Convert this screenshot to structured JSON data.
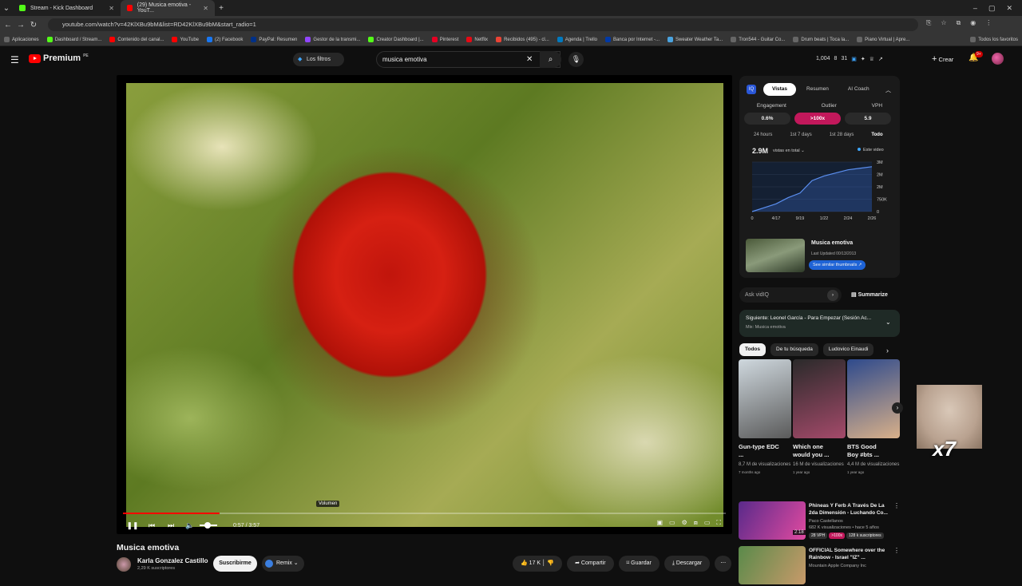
{
  "browser": {
    "tabs": [
      {
        "title": "Stream - Kick Dashboard",
        "color": "#53fc18"
      },
      {
        "title": "(29) Musica emotiva - YouT...",
        "color": "#ff0000"
      }
    ],
    "url": "youtube.com/watch?v=42KlXBu9bM&list=RD42KlXBu9bM&start_radio=1",
    "bookmarks": [
      "Aplicaciones",
      "Dashboard / Stream...",
      "Contenido del canal...",
      "YouTube",
      "(2) Facebook",
      "PayPal: Resumen",
      "Gestor de la transmi...",
      "Creator Dashboard |...",
      "Pinterest",
      "Netflix",
      "Recibidos (495) - cl...",
      "Agenda | Trello",
      "Banca por Internet -...",
      "Sweater Weather Ta...",
      "Tron544 - Guitar Co...",
      "Drum beats | Toca la...",
      "Piano Virtual | Apre...",
      "Todos los favoritos"
    ]
  },
  "header": {
    "logo": "Premium",
    "region": "PE",
    "filters_label": "Los filtros",
    "search_value": "musica emotiva",
    "stats": [
      "1,004",
      "8",
      "31"
    ],
    "create_label": "Crear",
    "notif_count": "9+"
  },
  "player": {
    "volume_tooltip": "Volumen",
    "time": "0:57 / 3:57",
    "progress": 0.16
  },
  "video": {
    "title": "Musica emotiva",
    "channel": "Karla Gonzalez Castillo",
    "subscribers": "2,29 K suscriptores",
    "subscribe_label": "Suscribirme",
    "remix_label": "Remix",
    "likes": "17 K",
    "share_label": "Compartir",
    "save_label": "Guardar",
    "download_label": "Descargar"
  },
  "vidiq": {
    "tabs": [
      "Vistas",
      "Resumen",
      "AI Coach"
    ],
    "metric_labels": [
      "Engagement",
      "Outlier",
      "VPH"
    ],
    "metric_values": [
      "0.6%",
      ">100x",
      "5.9"
    ],
    "periods": [
      "24 hours",
      "1st 7 days",
      "1st 28 days",
      "Todo"
    ],
    "total": "2.9M",
    "total_label": "vistas en total",
    "this_video": "Este video",
    "thumb_title": "Musica emotiva",
    "thumb_date": "Last Updated 00/13/2013",
    "thumb_button": "See similar thumbnails",
    "ask_placeholder": "Ask vidIQ",
    "summarize": "Summarize"
  },
  "chart_data": {
    "type": "line",
    "x": [
      "0",
      "4/17",
      "9/19",
      "1/22",
      "2/24",
      "2/26"
    ],
    "y_ticks": [
      "3M",
      "2M",
      "2M",
      "750K",
      "0"
    ],
    "series": [
      {
        "values": [
          0,
          0.25,
          0.5,
          0.9,
          1.2,
          2.0,
          2.3,
          2.5,
          2.7,
          2.8,
          2.9
        ]
      }
    ],
    "ylim": [
      0,
      3.2
    ]
  },
  "upnext": {
    "title": "Siguiente: Leonel García - Para Empezar (Sesión Ac...",
    "sub": "Mix: Musica emotiva"
  },
  "chips": [
    "Todos",
    "De tu búsqueda",
    "Ludovico Einaudi"
  ],
  "shorts": [
    {
      "title": "Gun-type EDC ...",
      "views": "8,7 M de visualizaciones",
      "age": "7 months ago",
      "c1": "#cfd8de",
      "c2": "#5a5a5a"
    },
    {
      "title": "Which one would you ...",
      "views": "16 M de visualizaciones",
      "age": "1 year ago",
      "c1": "#2a2a2a",
      "c2": "#a44a6a"
    },
    {
      "title": "BTS Good Boy #bts ...",
      "views": "4,4 M de visualizaciones",
      "age": "1 year ago",
      "c1": "#2e4a8c",
      "c2": "#d8b08a"
    }
  ],
  "overlay_text": "x7",
  "videos": [
    {
      "title": "Phineas Y Ferb A Través De La 2da Dimensión - Luchando Co...",
      "channel": "Paco Castellanos",
      "meta": "682 K visualizaciones • hace 5 años",
      "duration": "2:18",
      "tags": [
        "28 VPH",
        ">100x",
        "128 k suscriptores"
      ],
      "c1": "#5a2a8a",
      "c2": "#e04aa0"
    },
    {
      "title": "OFFICIAL Somewhere over the Rainbow - Israel \"IZ\" ...",
      "channel": "Mountain Apple Company Inc",
      "meta": "",
      "duration": "",
      "tags": [],
      "c1": "#5a8a4a",
      "c2": "#c89a6a"
    }
  ]
}
